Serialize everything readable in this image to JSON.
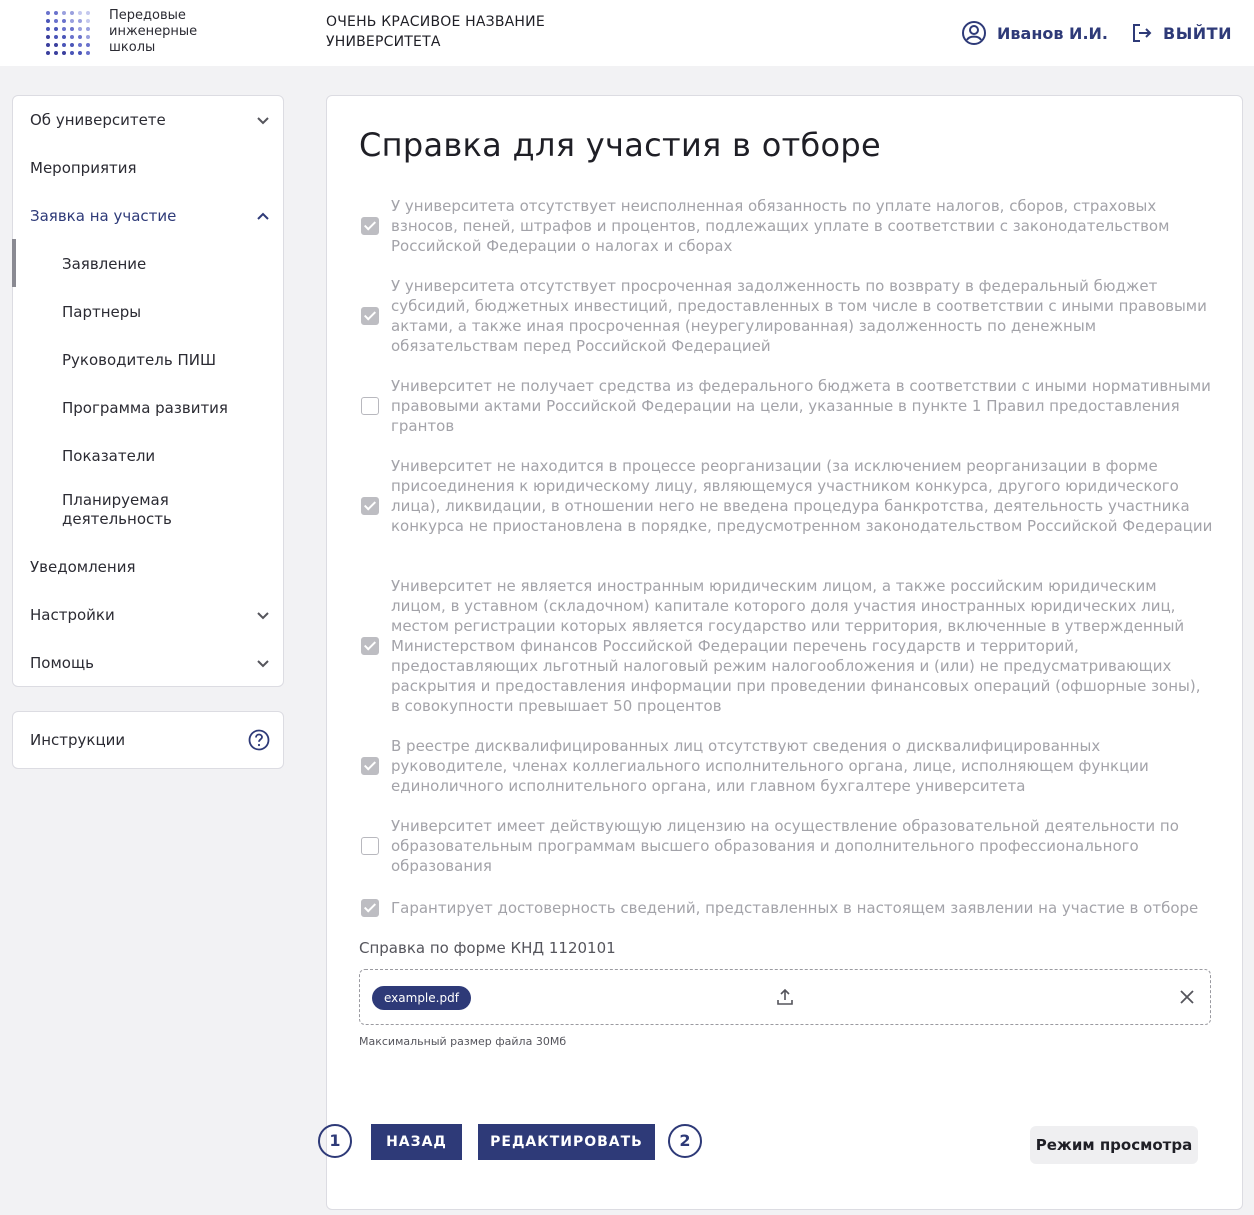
{
  "header": {
    "logo_text": "Передовые инженерные школы",
    "university_name": "ОЧЕНЬ КРАСИВОЕ НАЗВАНИЕ УНИВЕРСИТЕТА",
    "user_name": "Иванов И.И.",
    "logout_label": "ВЫЙТИ",
    "accent_color": "#2e3a78"
  },
  "sidebar": {
    "items": [
      {
        "label": "Об университете",
        "icon": "chevron-down-icon"
      },
      {
        "label": "Мероприятия"
      },
      {
        "label": "Заявка на участие",
        "icon": "chevron-up-icon"
      },
      {
        "label": "Заявление"
      },
      {
        "label": "Партнеры"
      },
      {
        "label": "Руководитель ПИШ"
      },
      {
        "label": "Программа развития"
      },
      {
        "label": "Показатели"
      },
      {
        "label": "Планируемая деятельность"
      },
      {
        "label": "Уведомления"
      },
      {
        "label": "Настройки",
        "icon": "chevron-down-icon"
      },
      {
        "label": "Помощь",
        "icon": "chevron-down-icon"
      }
    ],
    "help_label": "Инструкции"
  },
  "main": {
    "title": "Справка для участия в отборе",
    "checks": [
      {
        "checked": true,
        "text": "У университета отсутствует неисполненная обязанность по уплате налогов, сборов, страховых взносов, пеней, штрафов и процентов, подлежащих уплате в соответствии с законодательством Российской Федерации о налогах и сборах"
      },
      {
        "checked": true,
        "text": "У университета отсутствует просроченная задолженность по возврату в федеральный бюджет субсидий, бюджетных инвестиций, предоставленных в том числе в соответствии с иными правовыми актами, а также иная просроченная (неурегулированная) задолженность по денежным обязательствам перед Российской Федерацией"
      },
      {
        "checked": false,
        "text": "Университет не получает средства из федерального бюджета в соответствии с иными нормативными правовыми актами Российской Федерации на цели, указанные в пункте 1 Правил предоставления грантов"
      },
      {
        "checked": true,
        "text": "Университет не находится в процессе реорганизации (за исключением реорганизации в форме присоединения к юридическому лицу, являющемуся участником конкурса, другого юридического лица), ликвидации, в отношении него не введена процедура банкротства, деятельность участника конкурса не приостановлена в порядке, предусмотренном законодательством Российской Федерации"
      },
      {
        "checked": true,
        "text": "Университет не является иностранным юридическим лицом, а также российским юридическим лицом, в уставном (складочном) капитале которого доля участия иностранных юридических лиц, местом регистрации которых является государство или территория, включенные в утвержденный Министерством финансов Российской Федерации перечень государств и территорий, предоставляющих льготный налоговый режим налогообложения и (или) не предусматривающих раскрытия и предоставления информации при проведении финансовых операций (офшорные зоны), в совокупности превышает 50 процентов"
      },
      {
        "checked": true,
        "text": "В реестре дисквалифицированных лиц отсутствуют сведения о дисквалифицированных руководителе, членах коллегиального исполнительного органа, лице, исполняющем функции единоличного исполнительного органа, или главном бухгалтере университета"
      },
      {
        "checked": false,
        "text": "Университет имеет действующую лицензию на осуществление образовательной деятельности по образовательным программам высшего образования и дополнительного профессионального образования"
      },
      {
        "checked": true,
        "text": "Гарантирует достоверность сведений, представленных в настоящем заявлении на участие в отборе"
      }
    ],
    "file_label": "Справка по форме КНД 1120101",
    "file_name": "example.pdf",
    "file_hint": "Максимальный размер файла 30Мб",
    "step1": "1",
    "step2": "2",
    "back_label": "НАЗАД",
    "edit_label": "РЕДАКТИРОВАТЬ",
    "view_mode_label": "Режим просмотра"
  }
}
